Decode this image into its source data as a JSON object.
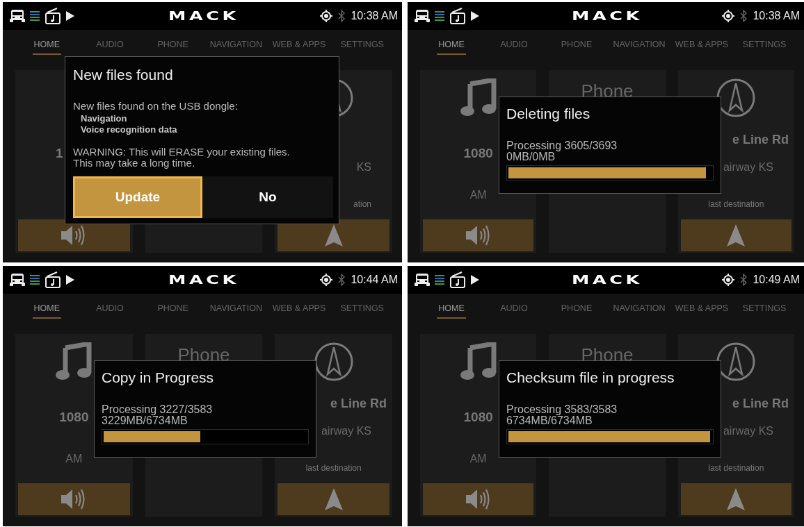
{
  "panels": [
    {
      "status": {
        "logo": "MACK",
        "time": "10:38 AM"
      },
      "tabs": [
        {
          "label": "HOME",
          "selected": true
        },
        {
          "label": "AUDIO",
          "selected": false
        },
        {
          "label": "PHONE",
          "selected": false
        },
        {
          "label": "NAVIGATION",
          "selected": false
        },
        {
          "label": "WEB & APPS",
          "selected": false
        },
        {
          "label": "SETTINGS",
          "selected": false
        }
      ],
      "cards": [
        {
          "kind": "audio",
          "icon_shown": false,
          "lines": [
            {
              "kind": "frequency",
              "text": "1",
              "clipped": true
            }
          ]
        },
        {
          "kind": "phone"
        },
        {
          "kind": "navigation",
          "icon_shown": true,
          "lines": [
            {
              "kind": "city",
              "text": "KS",
              "clipped": true
            },
            {
              "kind": "hint",
              "text": "ation",
              "clipped": true
            }
          ]
        }
      ],
      "dialog": {
        "kind": "prompt",
        "title": "New files found",
        "message": "New files found on the USB dongle:",
        "items": [
          "Navigation",
          "Voice recognition data"
        ],
        "warning": [
          "WARNING: This will ERASE your existing files.",
          "This may take a long time."
        ],
        "buttons": [
          {
            "label": "Update",
            "selected": true
          },
          {
            "label": "No",
            "selected": false
          }
        ]
      }
    },
    {
      "status": {
        "logo": "MACK",
        "time": "10:38 AM"
      },
      "tabs": [
        {
          "label": "HOME",
          "selected": true
        },
        {
          "label": "AUDIO",
          "selected": false
        },
        {
          "label": "PHONE",
          "selected": false
        },
        {
          "label": "NAVIGATION",
          "selected": false
        },
        {
          "label": "WEB & APPS",
          "selected": false
        },
        {
          "label": "SETTINGS",
          "selected": false
        }
      ],
      "cards": [
        {
          "kind": "audio",
          "icon_shown": true,
          "lines": [
            {
              "kind": "frequency",
              "text": "1080",
              "clipped": false
            },
            {
              "kind": "band",
              "text": "AM",
              "clipped": false
            }
          ]
        },
        {
          "kind": "phone",
          "lines": [
            {
              "kind": "heading",
              "text": "Phone",
              "clipped": false
            }
          ]
        },
        {
          "kind": "navigation",
          "icon_shown": true,
          "lines": [
            {
              "kind": "street",
              "text": "e Line Rd",
              "clipped": true
            },
            {
              "kind": "city",
              "text": "airway KS",
              "clipped": true
            },
            {
              "kind": "hint",
              "text": "last destination",
              "clipped": false
            }
          ]
        }
      ],
      "dialog": {
        "kind": "progress",
        "title": "Deleting files",
        "lines": [
          "Processing 3605/3693",
          "0MB/0MB"
        ],
        "level": 0.98
      }
    },
    {
      "status": {
        "logo": "MACK",
        "time": "10:44 AM"
      },
      "tabs": [
        {
          "label": "HOME",
          "selected": true
        },
        {
          "label": "AUDIO",
          "selected": false
        },
        {
          "label": "PHONE",
          "selected": false
        },
        {
          "label": "NAVIGATION",
          "selected": false
        },
        {
          "label": "WEB & APPS",
          "selected": false
        },
        {
          "label": "SETTINGS",
          "selected": false
        }
      ],
      "cards": [
        {
          "kind": "audio",
          "icon_shown": true,
          "lines": [
            {
              "kind": "frequency",
              "text": "1080",
              "clipped": false
            },
            {
              "kind": "band",
              "text": "AM",
              "clipped": false
            }
          ]
        },
        {
          "kind": "phone",
          "lines": [
            {
              "kind": "heading",
              "text": "Phone",
              "clipped": false
            }
          ]
        },
        {
          "kind": "navigation",
          "icon_shown": true,
          "lines": [
            {
              "kind": "street",
              "text": "e Line Rd",
              "clipped": true
            },
            {
              "kind": "city",
              "text": "airway KS",
              "clipped": true
            },
            {
              "kind": "hint",
              "text": "last destination",
              "clipped": false
            }
          ]
        }
      ],
      "dialog": {
        "kind": "progress",
        "title": "Copy in Progress",
        "lines": [
          "Processing 3227/3583",
          "3229MB/6734MB"
        ],
        "level": 0.48
      }
    },
    {
      "status": {
        "logo": "MACK",
        "time": "10:49 AM"
      },
      "tabs": [
        {
          "label": "HOME",
          "selected": true
        },
        {
          "label": "AUDIO",
          "selected": false
        },
        {
          "label": "PHONE",
          "selected": false
        },
        {
          "label": "NAVIGATION",
          "selected": false
        },
        {
          "label": "WEB & APPS",
          "selected": false
        },
        {
          "label": "SETTINGS",
          "selected": false
        }
      ],
      "cards": [
        {
          "kind": "audio",
          "icon_shown": true,
          "lines": [
            {
              "kind": "frequency",
              "text": "1080",
              "clipped": false
            },
            {
              "kind": "band",
              "text": "AM",
              "clipped": false
            }
          ]
        },
        {
          "kind": "phone",
          "lines": [
            {
              "kind": "heading",
              "text": "Phone",
              "clipped": false
            }
          ]
        },
        {
          "kind": "navigation",
          "icon_shown": true,
          "lines": [
            {
              "kind": "street",
              "text": "e Line Rd",
              "clipped": true
            },
            {
              "kind": "city",
              "text": "airway KS",
              "clipped": true
            },
            {
              "kind": "hint",
              "text": "last destination",
              "clipped": false
            }
          ]
        }
      ],
      "dialog": {
        "kind": "progress",
        "title": "Checksum file in progress",
        "lines": [
          "Processing 3583/3583",
          "6734MB/6734MB"
        ],
        "level": 1.0
      }
    }
  ]
}
